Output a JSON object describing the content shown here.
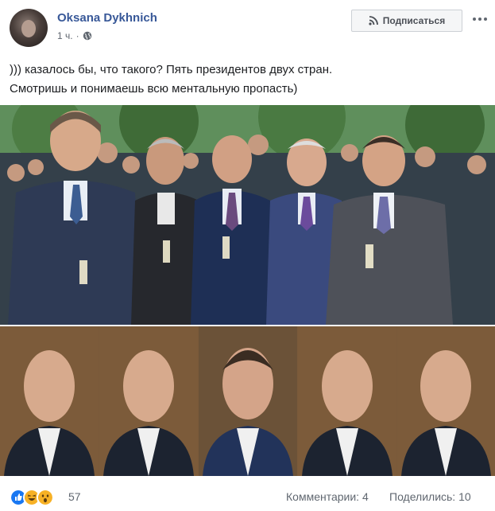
{
  "post": {
    "author": "Oksana Dykhnich",
    "time": "1 ч.",
    "subscribe_label": "Подписаться",
    "text_line1": "))) казалось бы, что такого? Пять президентов двух стран.",
    "text_line2": "Смотришь и понимаешь всю ментальную пропасть)"
  },
  "photos": {
    "top": {
      "description_icon": "group-photo"
    },
    "bottom": {
      "panels": 5
    }
  },
  "footer": {
    "reactions_icons": [
      "like-icon",
      "haha-icon",
      "wow-icon"
    ],
    "reactions_count": "57",
    "comments_label": "Комментарии: 4",
    "shares_label": "Поделились: 10"
  },
  "colors": {
    "link": "#385898",
    "like": "#1877f2",
    "emoji": "#f7b125"
  }
}
